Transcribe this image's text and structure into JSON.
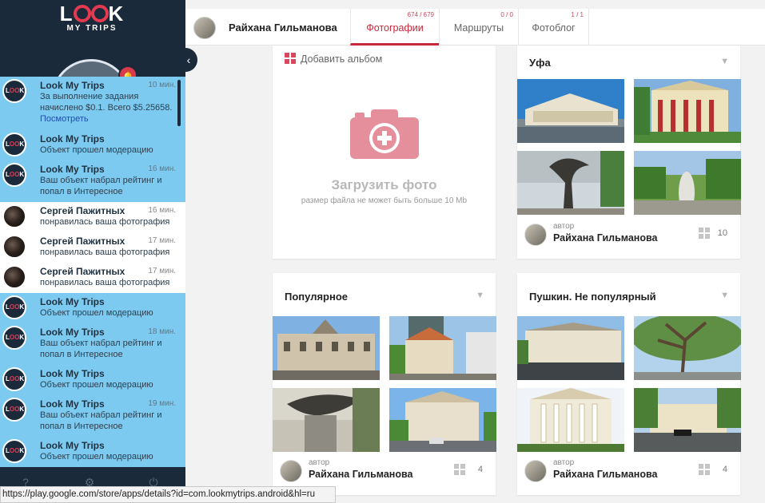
{
  "brand": {
    "logo_text_left": "L",
    "logo_text_right": "K",
    "logo_sub": "MY TRIPS"
  },
  "sidebar": {
    "collapse_icon": "chevron-left-icon",
    "notifications": [
      {
        "title": "Look My Trips",
        "time": "10 мин.",
        "text": "За выполнение задания начислено $0.1. Всего $5.25658.",
        "link": "Посмотреть",
        "style": "blue",
        "avatar": "logo"
      },
      {
        "title": "Look My Trips",
        "time": "",
        "text": "Объект прошел модерацию",
        "style": "blue",
        "avatar": "logo"
      },
      {
        "title": "Look My Trips",
        "time": "16 мин.",
        "text": "Ваш объект набрал рейтинг и попал в Интересное",
        "style": "blue",
        "avatar": "logo"
      },
      {
        "title": "Сергей Пажитных",
        "time": "16 мин.",
        "text": "понравилась ваша фотография",
        "style": "white",
        "avatar": "photo"
      },
      {
        "title": "Сергей Пажитных",
        "time": "17 мин.",
        "text": "понравилась ваша фотография",
        "style": "white",
        "avatar": "photo"
      },
      {
        "title": "Сергей Пажитных",
        "time": "17 мин.",
        "text": "понравилась ваша фотография",
        "style": "white",
        "avatar": "photo"
      },
      {
        "title": "Look My Trips",
        "time": "",
        "text": "Объект прошел модерацию",
        "style": "blue",
        "avatar": "logo"
      },
      {
        "title": "Look My Trips",
        "time": "18 мин.",
        "text": "Ваш объект набрал рейтинг и попал в Интересное",
        "style": "blue",
        "avatar": "logo"
      },
      {
        "title": "Look My Trips",
        "time": "",
        "text": "Объект прошел модерацию",
        "style": "blue",
        "avatar": "logo"
      },
      {
        "title": "Look My Trips",
        "time": "19 мин.",
        "text": "Ваш объект набрал рейтинг и попал в Интересное",
        "style": "blue",
        "avatar": "logo"
      },
      {
        "title": "Look My Trips",
        "time": "",
        "text": "Объект прошел модерацию",
        "style": "blue",
        "avatar": "logo"
      }
    ]
  },
  "statusbar": {
    "url": "https://play.google.com/store/apps/details?id=com.lookmytrips.android&hl=ru"
  },
  "header": {
    "user_name": "Райхана Гильманова",
    "tabs": [
      {
        "label": "Фотографии",
        "count": "674 / 679",
        "active": true
      },
      {
        "label": "Маршруты",
        "count": "0 / 0",
        "active": false
      },
      {
        "label": "Фотоблог",
        "count": "1 / 1",
        "active": false
      }
    ]
  },
  "upload_card": {
    "add_album": "Добавить альбом",
    "title": "Загрузить фото",
    "subtitle": "размер файла не может быть больше 10 Mb"
  },
  "albums": [
    {
      "title": "Уфа",
      "author_label": "автор",
      "author": "Райхана Гильманова",
      "count": "10"
    },
    {
      "title": "Популярное",
      "author_label": "автор",
      "author": "Райхана Гильманова",
      "count": "4"
    },
    {
      "title": "Пушкин. Не популярный",
      "author_label": "автор",
      "author": "Райхана Гильманова",
      "count": "4"
    }
  ],
  "colors": {
    "accent": "#c8283b",
    "sidebar_bg": "#1b2a3b",
    "notif_blue": "#7dcaf0",
    "camera": "#e58f9c"
  }
}
